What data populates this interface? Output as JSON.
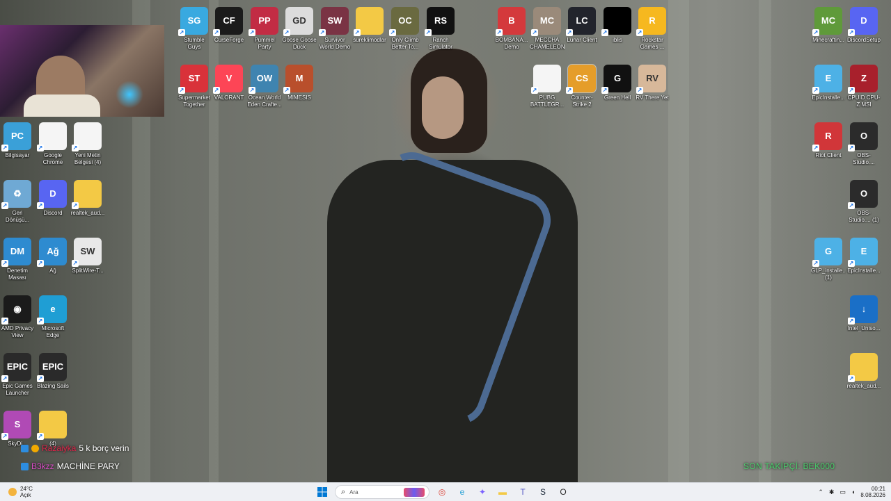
{
  "desktop": {
    "icons": [
      {
        "name": "stumble-guys",
        "label": "Stumble Guys",
        "glyph": "SG",
        "color": "#39a9e0"
      },
      {
        "name": "curseforge",
        "label": "CurseForge",
        "glyph": "CF",
        "color": "#1b1b1b"
      },
      {
        "name": "pummel-party",
        "label": "Pummel Party",
        "glyph": "PP",
        "color": "#c22c44"
      },
      {
        "name": "goose-goose-duck",
        "label": "Goose Goose Duck",
        "glyph": "GD",
        "color": "#dcdcdc"
      },
      {
        "name": "survivor-world-demo",
        "label": "Survivor World Demo",
        "glyph": "SW",
        "color": "#7a3344"
      },
      {
        "name": "sureklimodlar",
        "label": "sureklimodlar",
        "glyph": "",
        "color": "#f3c945"
      },
      {
        "name": "only-climb",
        "label": "Only Climb Better To...",
        "glyph": "OC",
        "color": "#6a6a40"
      },
      {
        "name": "ranch-simulator",
        "label": "Ranch Simulator",
        "glyph": "RS",
        "color": "#111111"
      },
      {
        "name": "bombana-demo",
        "label": "BOMBANA... Demo",
        "glyph": "B",
        "color": "#d4393c"
      },
      {
        "name": "meccha-chameleon",
        "label": "MECCHA CHAMELEON",
        "glyph": "MC",
        "color": "#9a8a7a"
      },
      {
        "name": "lunar-client",
        "label": "Lunar Client",
        "glyph": "LC",
        "color": "#22242c"
      },
      {
        "name": "iblis",
        "label": "iblis",
        "glyph": "",
        "color": "#000000"
      },
      {
        "name": "rockstar-games",
        "label": "Rockstar Games ...",
        "glyph": "R",
        "color": "#f6b81f"
      },
      {
        "name": "minecraft",
        "label": "Minecraftin...",
        "glyph": "MC",
        "color": "#5f9a3a"
      },
      {
        "name": "discord-setup",
        "label": "DiscordSetup",
        "glyph": "D",
        "color": "#5865f2"
      },
      {
        "name": "supermarket-together",
        "label": "Supermarket Together",
        "glyph": "ST",
        "color": "#d9323a"
      },
      {
        "name": "valorant",
        "label": "VALORANT",
        "glyph": "V",
        "color": "#fd4556"
      },
      {
        "name": "ocean-world",
        "label": "Ocean World Eden Crafte...",
        "glyph": "OW",
        "color": "#3f84b0"
      },
      {
        "name": "mimesis",
        "label": "MIMESIS",
        "glyph": "M",
        "color": "#b94f2c"
      },
      {
        "name": "pubg",
        "label": "PUBG BATTLEGR...",
        "glyph": "",
        "color": "#f5f5f5"
      },
      {
        "name": "counter-strike",
        "label": "Counter-Strike 2",
        "glyph": "CS",
        "color": "#e59d2a"
      },
      {
        "name": "green-hell",
        "label": "Green Hell",
        "glyph": "G",
        "color": "#111111"
      },
      {
        "name": "rv-there-yet",
        "label": "RV There Yet",
        "glyph": "RV",
        "color": "#d7b89a"
      },
      {
        "name": "epic-installer-1",
        "label": "EpicInstalle...",
        "glyph": "E",
        "color": "#4db1e6"
      },
      {
        "name": "cpuid-cpu-z",
        "label": "CPUID CPU-Z MSI",
        "glyph": "Z",
        "color": "#a8202c"
      },
      {
        "name": "bilgisayar",
        "label": "Bilgisayar",
        "glyph": "PC",
        "color": "#3aa0d8"
      },
      {
        "name": "google-chrome",
        "label": "Google Chrome",
        "glyph": "",
        "color": "#f5f5f5"
      },
      {
        "name": "yeni-metin-belgesi",
        "label": "Yeni Metin Belgesi (4)",
        "glyph": "",
        "color": "#f5f5f5"
      },
      {
        "name": "riot-client",
        "label": "Riot Client",
        "glyph": "R",
        "color": "#d13639"
      },
      {
        "name": "obs-studio-1",
        "label": "OBS-Studio....",
        "glyph": "O",
        "color": "#2b2b2b"
      },
      {
        "name": "geri-donusum",
        "label": "Geri Dönüşü...",
        "glyph": "♻",
        "color": "#6fa9d4"
      },
      {
        "name": "discord",
        "label": "Discord",
        "glyph": "D",
        "color": "#5865f2"
      },
      {
        "name": "realtek-audio-1",
        "label": "realtek_aud...",
        "glyph": "",
        "color": "#f3c945"
      },
      {
        "name": "obs-studio-2",
        "label": "OBS-Studio.... (1)",
        "glyph": "O",
        "color": "#2b2b2b"
      },
      {
        "name": "denetim-masasi",
        "label": "Denetim Masası",
        "glyph": "DM",
        "color": "#2e8bd0"
      },
      {
        "name": "ag",
        "label": "Ağ",
        "glyph": "Ağ",
        "color": "#2e8bd0"
      },
      {
        "name": "splitwire",
        "label": "SplitWire-T...",
        "glyph": "SW",
        "color": "#e8e8e8"
      },
      {
        "name": "glp-installer",
        "label": "GLP_installe... (1)",
        "glyph": "G",
        "color": "#4db1e6"
      },
      {
        "name": "epic-installer-2",
        "label": "EpicInstalle...",
        "glyph": "E",
        "color": "#4db1e6"
      },
      {
        "name": "amd-privacy-view",
        "label": "AMD Privacy View",
        "glyph": "◉",
        "color": "#1b1b1b"
      },
      {
        "name": "microsoft-edge",
        "label": "Microsoft Edge",
        "glyph": "e",
        "color": "#1f9ed4"
      },
      {
        "name": "intel-uniso",
        "label": "Intel_Uniso...",
        "glyph": "↓",
        "color": "#1a6fc7"
      },
      {
        "name": "epic-games-launcher",
        "label": "Epic Games Launcher",
        "glyph": "EPIC",
        "color": "#2a2a2a"
      },
      {
        "name": "blazing-sails",
        "label": "Blazing Sails",
        "glyph": "EPIC",
        "color": "#2a2a2a"
      },
      {
        "name": "realtek-audio-2",
        "label": "realtek_aud...",
        "glyph": "",
        "color": "#f3c945"
      },
      {
        "name": "skydive",
        "label": "SkyDi...",
        "glyph": "S",
        "color": "#b04ab5"
      },
      {
        "name": "folder-4",
        "label": "(4)",
        "glyph": "",
        "color": "#f3c945"
      }
    ]
  },
  "overlay": {
    "chat": [
      {
        "user": "Razaiyka",
        "message": "5 k borç verin"
      },
      {
        "user": "B3kzz",
        "message": "MACHİNE PARY"
      }
    ],
    "follower": "SON TAKİPÇİ: BEK000"
  },
  "taskbar": {
    "weather_temp": "24°C",
    "weather_state": "Açık",
    "search_placeholder": "Ara",
    "apps": [
      {
        "name": "chrome-taskbar-icon",
        "glyph": "◎",
        "color": "#db4437"
      },
      {
        "name": "edge-taskbar-icon",
        "glyph": "e",
        "color": "#1f9ed4"
      },
      {
        "name": "copilot-taskbar-icon",
        "glyph": "✦",
        "color": "#7b61ff"
      },
      {
        "name": "explorer-taskbar-icon",
        "glyph": "▬",
        "color": "#f3c945"
      },
      {
        "name": "teams-taskbar-icon",
        "glyph": "T",
        "color": "#5b5fc7"
      },
      {
        "name": "steam-taskbar-icon",
        "glyph": "S",
        "color": "#1b2838"
      },
      {
        "name": "obs-taskbar-icon",
        "glyph": "O",
        "color": "#2b2b2b"
      }
    ],
    "time": "00:21",
    "date": "8.08.2026"
  }
}
